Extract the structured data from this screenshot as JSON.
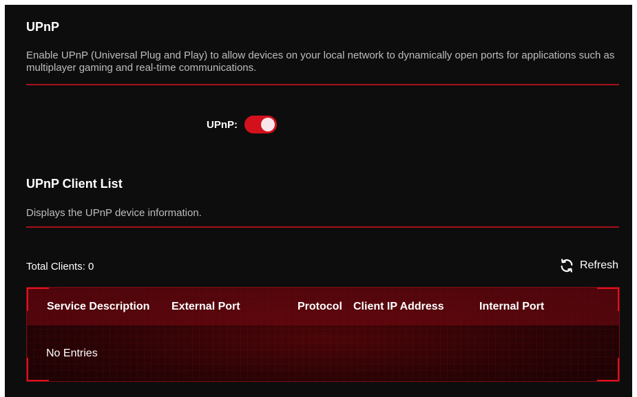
{
  "upnp": {
    "title": "UPnP",
    "description": "Enable UPnP (Universal Plug and Play) to allow devices on your local network to dynamically open ports for applications such as multiplayer gaming and real-time communications.",
    "toggle_label": "UPnP:",
    "enabled": true
  },
  "client_list": {
    "title": "UPnP Client List",
    "description": "Displays the UPnP device information.",
    "total_label": "Total Clients: 0",
    "refresh_label": "Refresh",
    "columns": [
      "Service Description",
      "External Port",
      "Protocol",
      "Client IP Address",
      "Internal Port"
    ],
    "empty_text": "No Entries"
  },
  "colors": {
    "accent": "#d3111d",
    "background": "#0d0d0d"
  },
  "icons": {
    "refresh": "refresh-icon"
  }
}
